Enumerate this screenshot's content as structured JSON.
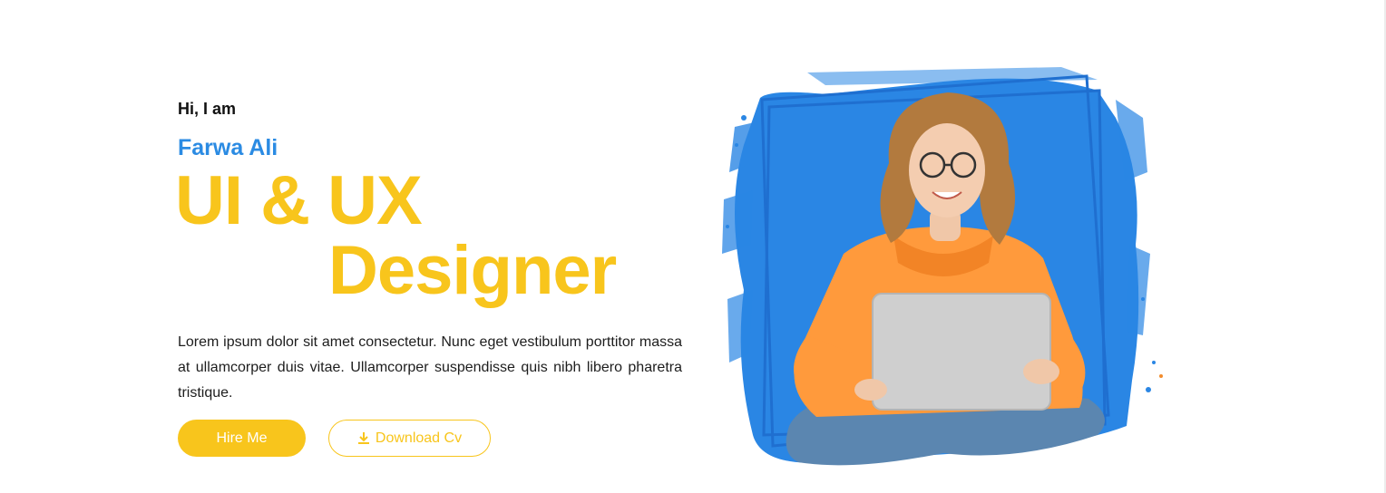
{
  "hero": {
    "greeting": "Hi, I am",
    "name": "Farwa Ali",
    "role_line1": "UI & UX",
    "role_line2": "Designer",
    "description": "Lorem ipsum dolor sit amet consectetur. Nunc eget vestibulum porttitor massa at ullamcorper duis vitae. Ullamcorper suspendisse quis nibh libero pharetra tristique.",
    "hire_label": "Hire Me",
    "download_label": "Download Cv"
  },
  "icons": {
    "download": "download-icon"
  },
  "colors": {
    "accent_yellow": "#f8c51c",
    "accent_blue": "#2b8be3",
    "hoodie_orange": "#ff9a3c",
    "text_dark": "#1d1d1d"
  }
}
